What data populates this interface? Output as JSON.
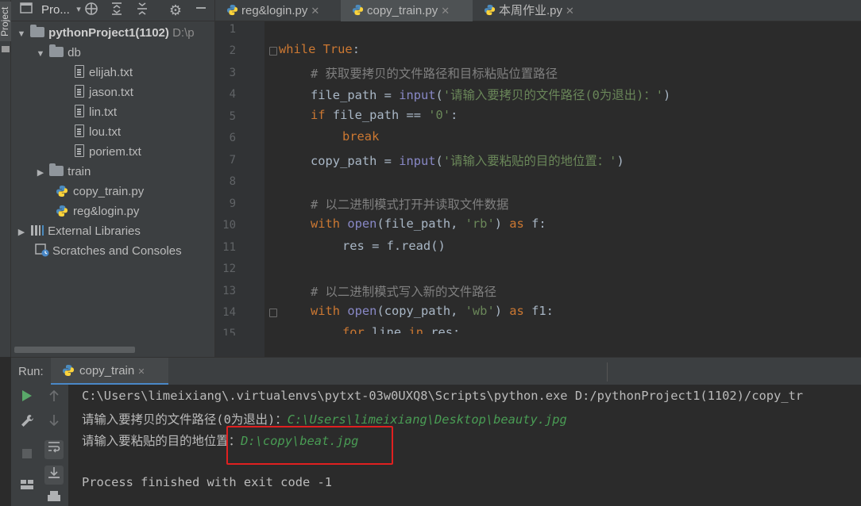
{
  "sidebar_strip": {
    "label": "Project"
  },
  "project_panel": {
    "title": "Pro...",
    "tree": [
      {
        "label": "pythonProject1(1102)",
        "suffix": "D:\\p",
        "type": "root"
      },
      {
        "label": "db",
        "type": "folder"
      },
      {
        "label": "elijah.txt",
        "type": "file"
      },
      {
        "label": "jason.txt",
        "type": "file"
      },
      {
        "label": "lin.txt",
        "type": "file"
      },
      {
        "label": "lou.txt",
        "type": "file"
      },
      {
        "label": "poriem.txt",
        "type": "file"
      },
      {
        "label": "train",
        "type": "folder"
      },
      {
        "label": "copy_train.py",
        "type": "python"
      },
      {
        "label": "reg&login.py",
        "type": "python"
      },
      {
        "label": "External Libraries",
        "type": "libraries"
      },
      {
        "label": "Scratches and Consoles",
        "type": "scratches"
      }
    ]
  },
  "editor": {
    "tabs": [
      {
        "label": "reg&login.py",
        "active": false
      },
      {
        "label": "copy_train.py",
        "active": true
      },
      {
        "label": "本周作业.py",
        "active": false
      }
    ],
    "line_numbers": [
      "1",
      "2",
      "3",
      "4",
      "5",
      "6",
      "7",
      "8",
      "9",
      "10",
      "11",
      "12",
      "13",
      "14",
      "15"
    ],
    "code": {
      "l2_kw1": "while",
      "l2_kw2": "True",
      "l2_colon": ":",
      "l3_comment": "# 获取要拷贝的文件路径和目标粘贴位置路径",
      "l4_var": "file_path = ",
      "l4_fn": "input",
      "l4_p1": "(",
      "l4_str": "'请输入要拷贝的文件路径(0为退出)：'",
      "l4_p2": ")",
      "l5_kw": "if",
      "l5_rest": " file_path == ",
      "l5_str": "'0'",
      "l5_colon": ":",
      "l6_kw": "break",
      "l7_var": "copy_path = ",
      "l7_fn": "input",
      "l7_p1": "(",
      "l7_str": "'请输入要粘贴的目的地位置：'",
      "l7_p2": ")",
      "l9_comment": "# 以二进制模式打开并读取文件数据",
      "l10_kw": "with",
      "l10_fn": "open",
      "l10_args": "(file_path, ",
      "l10_str": "'rb'",
      "l10_p2": ") ",
      "l10_as": "as",
      "l10_end": " f:",
      "l11_code": "res = f.read()",
      "l13_comment": "# 以二进制模式写入新的文件路径",
      "l14_kw": "with",
      "l14_fn": "open",
      "l14_args": "(copy_path, ",
      "l14_str": "'wb'",
      "l14_p2": ") ",
      "l14_as": "as",
      "l14_end": " f1:",
      "l15_kw1": "for",
      "l15_mid": " line ",
      "l15_kw2": "in",
      "l15_end": " res:"
    }
  },
  "run_panel": {
    "label": "Run:",
    "tab_label": "copy_train",
    "console": {
      "line1": "C:\\Users\\limeixiang\\.virtualenvs\\pytxt-03w0UXQ8\\Scripts\\python.exe D:/pythonProject1(1102)/copy_tr",
      "line2_prompt": "请输入要拷贝的文件路径(0为退出)：",
      "line2_input": "C:\\Users\\limeixiang\\Desktop\\beauty.jpg",
      "line3_prompt": "请输入要粘贴的目的地位置：",
      "line3_input": "D:\\copy\\beat.jpg",
      "line5": "Process finished with exit code -1"
    }
  },
  "colors": {
    "keyword": "#cc7832",
    "string": "#6a8759",
    "builtin": "#8888c6",
    "comment": "#808080",
    "console_input": "#499c54",
    "highlight_box": "#e02020"
  }
}
